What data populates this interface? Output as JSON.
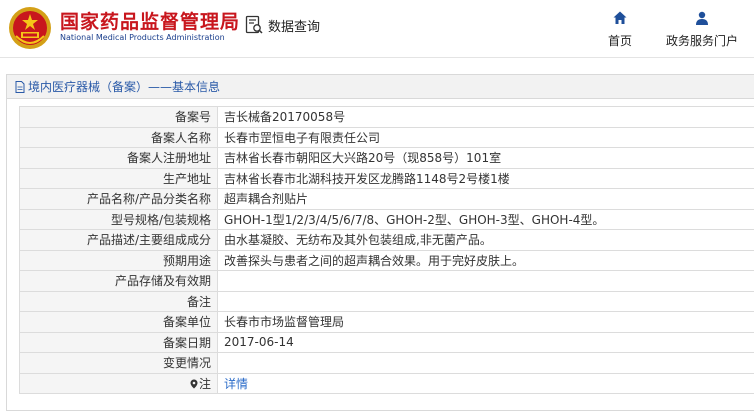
{
  "header": {
    "logo_cn": "国家药品监督管理局",
    "logo_en": "National Medical Products Administration",
    "query_label": "数据查询",
    "nav": [
      {
        "label": "首页",
        "icon": "home-icon"
      },
      {
        "label": "政务服务门户",
        "icon": "user-icon"
      }
    ]
  },
  "colors": {
    "brand_red": "#c8161d",
    "brand_blue": "#1a3e8c",
    "nav_blue": "#1f4f9a",
    "link_blue": "#2a6bc9"
  },
  "panel": {
    "title": "境内医疗器械（备案）——基本信息",
    "rows": [
      {
        "label": "备案号",
        "value": "吉长械备20170058号"
      },
      {
        "label": "备案人名称",
        "value": "长春市罡恒电子有限责任公司"
      },
      {
        "label": "备案人注册地址",
        "value": "吉林省长春市朝阳区大兴路20号（现858号）101室"
      },
      {
        "label": "生产地址",
        "value": "吉林省长春市北湖科技开发区龙腾路1148号2号楼1楼"
      },
      {
        "label": "产品名称/产品分类名称",
        "value": "超声耦合剂贴片"
      },
      {
        "label": "型号规格/包装规格",
        "value": "GHOH-1型1/2/3/4/5/6/7/8、GHOH-2型、GHOH-3型、GHOH-4型。"
      },
      {
        "label": "产品描述/主要组成成分",
        "value": "由水基凝胶、无纺布及其外包装组成,非无菌产品。"
      },
      {
        "label": "预期用途",
        "value": "改善探头与患者之间的超声耦合效果。用于完好皮肤上。"
      },
      {
        "label": "产品存储及有效期",
        "value": ""
      },
      {
        "label": "备注",
        "value": ""
      },
      {
        "label": "备案单位",
        "value": "长春市市场监督管理局"
      },
      {
        "label": "备案日期",
        "value": "2017-06-14"
      },
      {
        "label": "变更情况",
        "value": ""
      },
      {
        "label": "注",
        "value": "详情"
      }
    ]
  }
}
